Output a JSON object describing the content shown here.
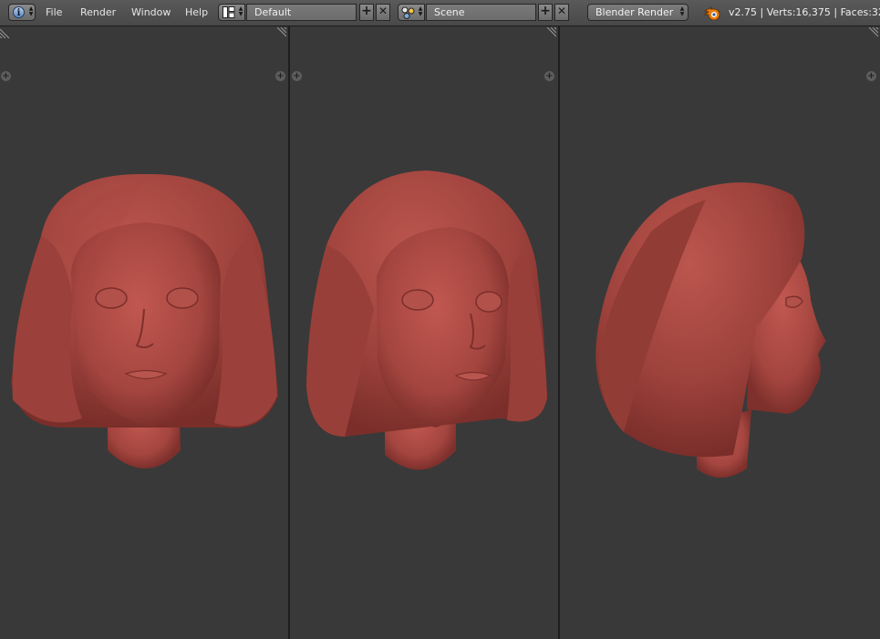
{
  "topbar": {
    "menus": [
      "File",
      "Render",
      "Window",
      "Help"
    ],
    "layout": {
      "value": "Default"
    },
    "scene": {
      "value": "Scene"
    },
    "render_engine": "Blender Render",
    "stats": "v2.75 | Verts:16,375 | Faces:32,"
  },
  "viewports": [
    {
      "name": "front",
      "view": "front"
    },
    {
      "name": "three-quarter",
      "view": "three-quarter"
    },
    {
      "name": "side",
      "view": "side"
    }
  ],
  "colors": {
    "mesh": "#a84a44",
    "viewport_bg": "#393939",
    "header_bg": "#4e4e4e"
  }
}
